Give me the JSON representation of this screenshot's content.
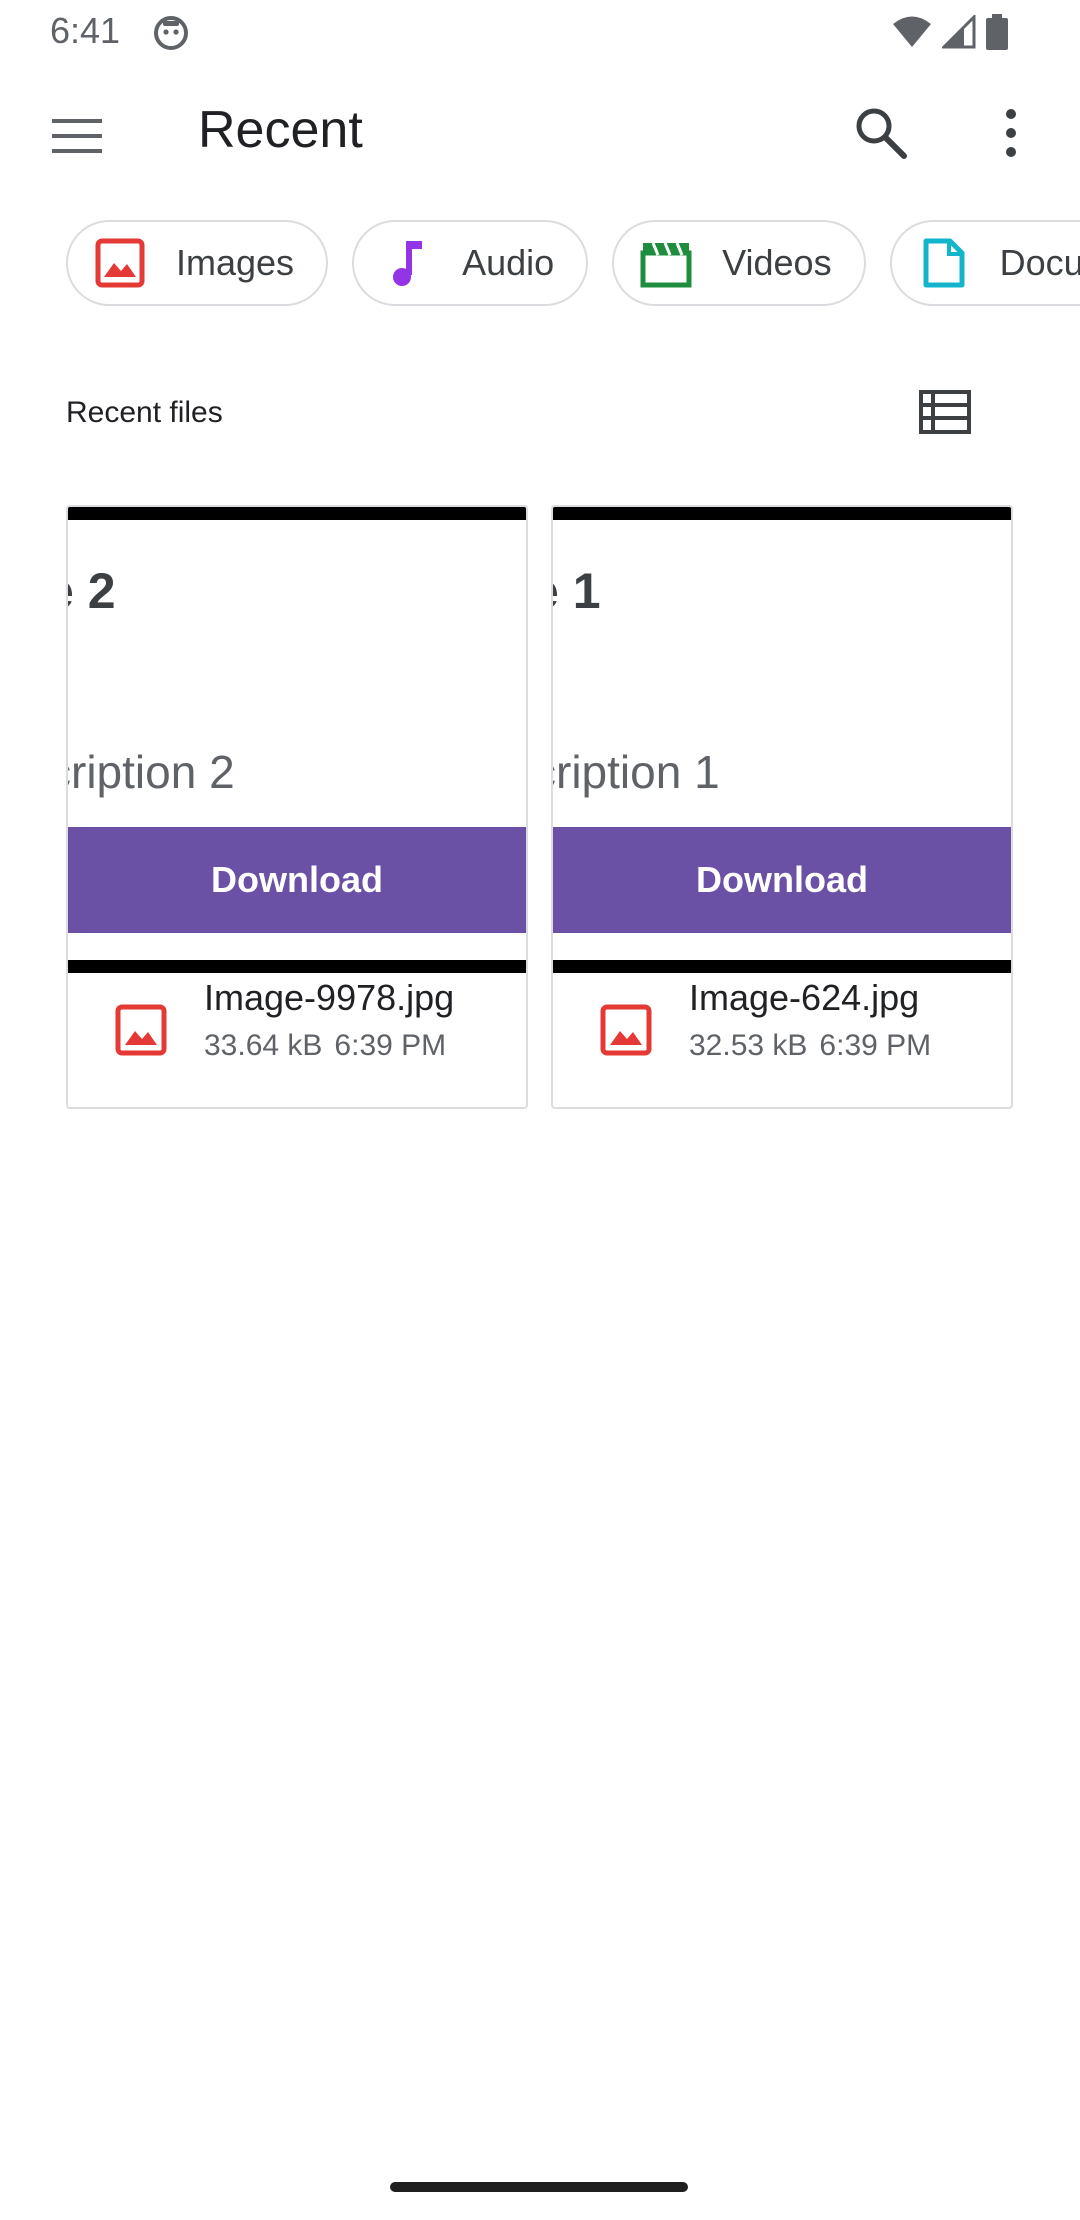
{
  "status_bar": {
    "time": "6:41"
  },
  "app_bar": {
    "title": "Recent"
  },
  "chips": [
    {
      "label": "Images",
      "icon": "image-icon",
      "color": "#e53935"
    },
    {
      "label": "Audio",
      "icon": "music-note-icon",
      "color": "#9334e6"
    },
    {
      "label": "Videos",
      "icon": "clapperboard-icon",
      "color": "#1e8e3e"
    },
    {
      "label": "Documents",
      "icon": "document-icon",
      "color": "#12b5cb"
    }
  ],
  "section": {
    "title": "Recent files"
  },
  "files": [
    {
      "thumb_title": "e 2",
      "thumb_desc": "cription 2",
      "thumb_button": "Download",
      "name": "Image-9978.jpg",
      "size": "33.64 kB",
      "time": "6:39 PM"
    },
    {
      "thumb_title": "e 1",
      "thumb_desc": "cription 1",
      "thumb_button": "Download",
      "name": "Image-624.jpg",
      "size": "32.53 kB",
      "time": "6:39 PM"
    }
  ],
  "colors": {
    "accent_purple": "#6b51a5",
    "image_red": "#e53935"
  }
}
